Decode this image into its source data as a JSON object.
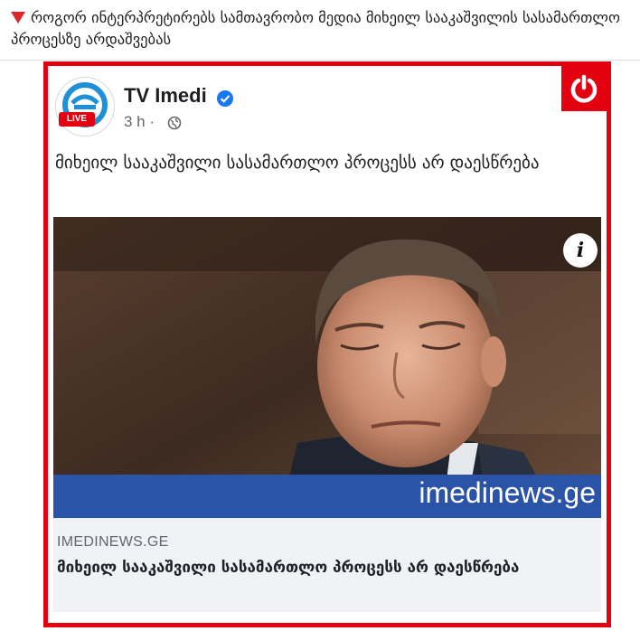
{
  "headline": "როგორ ინტერპრეტირებს სამთავრობო მედია მიხეილ სააკაშვილის სასამართლო პროცესზე არდაშვებას",
  "post": {
    "page_name": "TV Imedi",
    "avatar_badge": "LIVE",
    "timestamp": "3 h ·",
    "text": "მიხეილ სააკაშვილი სასამართლო პროცესს არ დაესწრება",
    "image": {
      "info_label": "i",
      "watermark": "imedinews.ge",
      "description_icon": "photo-of-man"
    },
    "link_preview": {
      "domain": "IMEDINEWS.GE",
      "title": "მიხეილ სააკაშვილი სასამართლო პროცესს არ დაესწრება"
    }
  },
  "colors": {
    "frame": "#e3000f",
    "verified": "#1877f2",
    "banner": "#2b54a8"
  },
  "icons": [
    "down-triangle-icon",
    "power-logo-icon",
    "verified-badge-icon",
    "globe-icon",
    "info-icon"
  ]
}
